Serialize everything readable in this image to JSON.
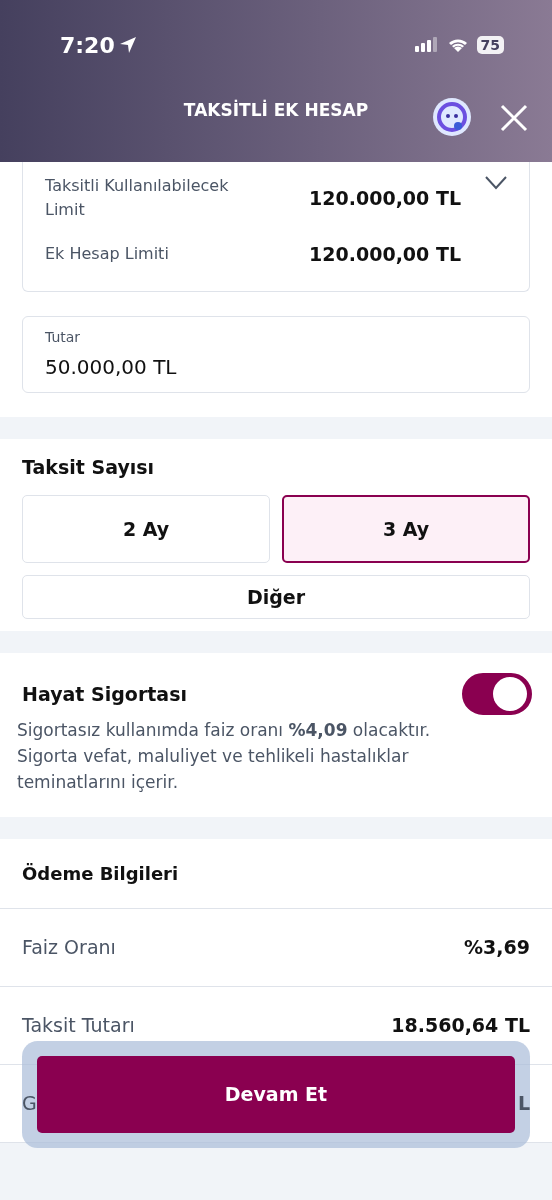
{
  "status_bar": {
    "time": "7:20",
    "battery": "75"
  },
  "header": {
    "title": "TAKSİTLİ EK HESAP"
  },
  "limits": {
    "expanded": true,
    "rows": [
      {
        "label": "Taksitli Kullanılabilecek Limit",
        "value": "120.000,00 TL"
      },
      {
        "label": "Ek Hesap Limiti",
        "value": "120.000,00 TL"
      }
    ]
  },
  "amount": {
    "label": "Tutar",
    "value": "50.000,00 TL"
  },
  "installments": {
    "title": "Taksit Sayısı",
    "options": [
      {
        "label": "2 Ay",
        "selected": false
      },
      {
        "label": "3 Ay",
        "selected": true
      }
    ],
    "other": "Diğer"
  },
  "insurance": {
    "title": "Hayat Sigortası",
    "on": true,
    "text": "Sigortasız kullanımda faiz oranı **%4,09** olacaktır. Sigorta vefat, maluliyet ve tehlikeli hastalıklar teminatlarını içerir."
  },
  "payment": {
    "title": "Ödeme Bilgileri",
    "rows": [
      {
        "label": "Faiz Oranı",
        "value": "%3,69"
      },
      {
        "label": "Taksit Tutarı",
        "value": "18.560,64 TL"
      },
      {
        "label": "G",
        "value": "L"
      }
    ]
  },
  "continue_button": "Devam Et"
}
